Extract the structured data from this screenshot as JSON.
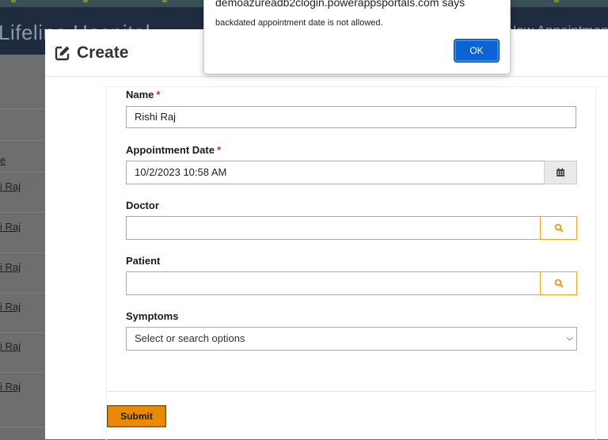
{
  "background": {
    "brand": "Lifeline Hospital",
    "header_right": "New Appointment",
    "links": [
      "i Raj",
      "i Raj",
      "i Raj",
      "i Raj",
      "i Raj",
      "i Raj"
    ],
    "column_fragment": "e"
  },
  "modal": {
    "title": "Create",
    "icon": "edit-icon",
    "fields": {
      "name": {
        "label": "Name",
        "required": "*",
        "value": "Rishi Raj"
      },
      "appointment_date": {
        "label": "Appointment Date",
        "required": "*",
        "value": "10/2/2023 10:58 AM",
        "button_icon": "calendar-icon"
      },
      "doctor": {
        "label": "Doctor",
        "value": "",
        "button_icon": "search-icon"
      },
      "patient": {
        "label": "Patient",
        "value": "",
        "button_icon": "search-icon"
      },
      "symptoms": {
        "label": "Symptoms",
        "placeholder": "Select or search options"
      }
    },
    "submit_label": "Submit"
  },
  "alert": {
    "origin": "demoazureadb2clogin.powerappsportals.com says",
    "message": "backdated appointment date is not allowed.",
    "ok_label": "OK"
  },
  "colors": {
    "submit": "#ea8a00",
    "search_border": "#f0a820",
    "ok_button": "#0a64d6",
    "header": "#1f2c3f"
  }
}
